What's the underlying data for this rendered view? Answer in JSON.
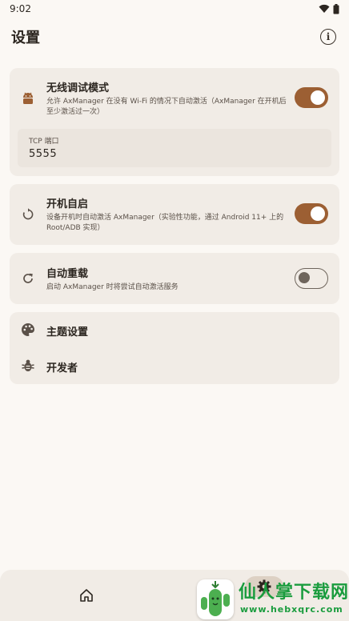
{
  "status_bar": {
    "time": "9:02",
    "wifi_icon": "wifi-icon",
    "battery_icon": "battery-icon"
  },
  "app_bar": {
    "title": "设置",
    "info_icon": "info-icon",
    "info_glyph": "i"
  },
  "wireless_debug": {
    "title": "无线调试模式",
    "description": "允许 AxManager 在没有 Wi-Fi 的情况下自动激活（AxManager 在开机后至少激活过一次）",
    "enabled": true,
    "port_label": "TCP 端口",
    "port_value": "5555"
  },
  "boot_start": {
    "title": "开机自启",
    "description": "设备开机时自动激活 AxManager（实验性功能，通过 Android 11+ 上的 Root/ADB 实现）",
    "enabled": true
  },
  "auto_reload": {
    "title": "自动重载",
    "description": "启动 AxManager 时将尝试自动激活服务",
    "enabled": false
  },
  "menu": {
    "theme_settings": "主题设置",
    "developer": "开发者"
  },
  "bottom_nav": {
    "items": [
      {
        "name": "home",
        "icon": "home-icon"
      },
      {
        "name": "settings",
        "icon": "settings-icon",
        "selected": true
      }
    ]
  },
  "watermark": {
    "text": "仙人掌下载网",
    "url": "www.hebxqrc.com"
  },
  "colors": {
    "accent": "#9c5f33",
    "card": "#f1ece6",
    "background": "#fbf8f4",
    "watermark": "#1a9c3e"
  }
}
